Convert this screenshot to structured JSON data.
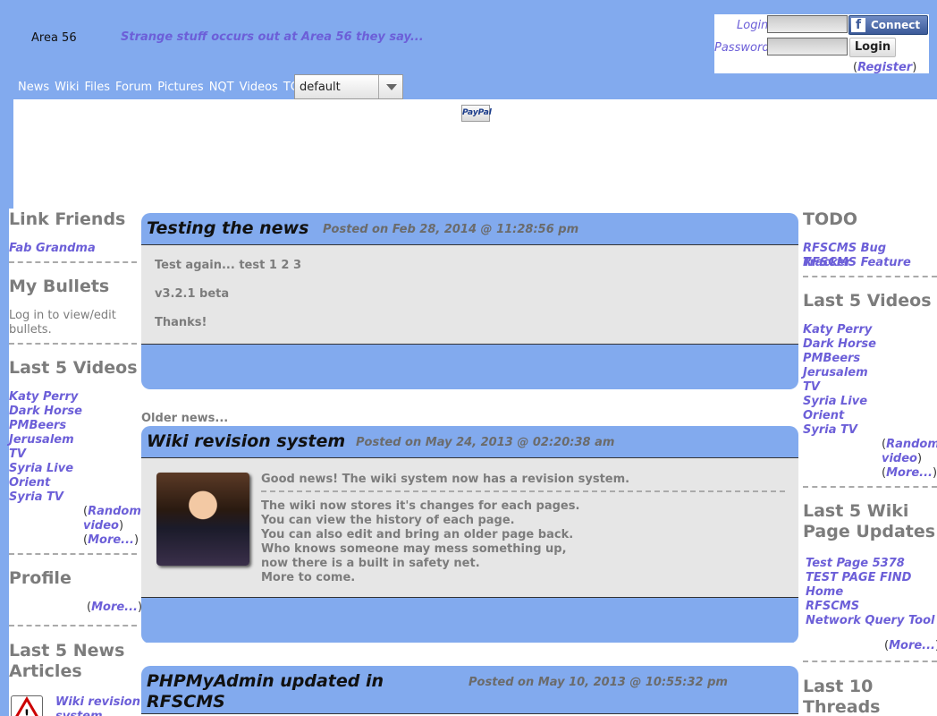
{
  "site": {
    "name": "Area 56",
    "tagline": "Strange stuff occurs out at Area 56 they say..."
  },
  "login": {
    "login_label": "Login",
    "password_label": "Password",
    "fb_label": "Connect",
    "login_button": "Login",
    "register_open": "(",
    "register_label": "Register",
    "register_close": ")"
  },
  "nav": [
    "News",
    "Wiki",
    "Files",
    "Forum",
    "Pictures",
    "NQT",
    "Videos",
    "TODO"
  ],
  "theme": {
    "selected": "default"
  },
  "paypal": "PayPal",
  "left": {
    "link_friends": {
      "title": "Link Friends",
      "items": [
        "Fab Grandma"
      ]
    },
    "bullets": {
      "title": "My Bullets",
      "text1": "Log in to view/edit",
      "text2": "bullets."
    },
    "videos": {
      "title": "Last 5 Videos",
      "items": [
        "Katy Perry",
        "Dark Horse",
        "PMBeers",
        "Jerusalem",
        "TV",
        "Syria Live",
        "Orient",
        "Syria TV"
      ],
      "random1": "Random",
      "random2": "video",
      "more": "More..."
    },
    "profile": {
      "title": "Profile",
      "more": "More..."
    },
    "news_articles": {
      "title1": "Last 5 News",
      "title2": "Articles",
      "item": "Wiki revision",
      "item2": "system"
    }
  },
  "news": [
    {
      "title": "Testing the news",
      "date": "Posted on Feb 28, 2014 @ 11:28:56 pm",
      "lines": [
        "Test again... test 1 2 3",
        "v3.2.1 beta",
        "Thanks!"
      ]
    },
    {
      "title": "Wiki revision system",
      "date": "Posted on May 24, 2013 @ 02:20:38 am",
      "lead": "Good news! The wiki system now has a revision system.",
      "lines": [
        "The wiki now stores it's changes for each pages.",
        "You can view the history of each page.",
        "You can also edit and bring an older page back.",
        "Who knows someone may mess something up,",
        "now there is a built in safety net.",
        "More to come."
      ]
    },
    {
      "title1": "PHPMyAdmin updated in",
      "title2": "RFSCMS",
      "date": "Posted on May 10, 2013 @ 10:55:32 pm"
    }
  ],
  "older_news": "Older news...",
  "right": {
    "todo": {
      "title": "TODO",
      "items": [
        "RFSCMS Bug Tracker",
        "RFSCMS Feature"
      ]
    },
    "videos": {
      "title": "Last 5 Videos",
      "items": [
        "Katy Perry",
        "Dark Horse",
        "PMBeers",
        "Jerusalem",
        "TV",
        "Syria Live",
        "Orient",
        "Syria TV"
      ],
      "random1": "Random",
      "random2": "video",
      "more": "More..."
    },
    "wiki": {
      "title1": "Last 5 Wiki",
      "title2": "Page Updates",
      "items": [
        "Test Page 5378",
        "TEST PAGE FIND",
        "Home",
        "RFSCMS",
        "Network Query Tool"
      ],
      "more": "More..."
    },
    "threads": {
      "title1": "Last 10",
      "title2": "Threads"
    }
  },
  "colors": {
    "header_blue": "#82aaee",
    "link_purple": "#6c5fd8",
    "panel_gray": "#e6e6e6"
  }
}
